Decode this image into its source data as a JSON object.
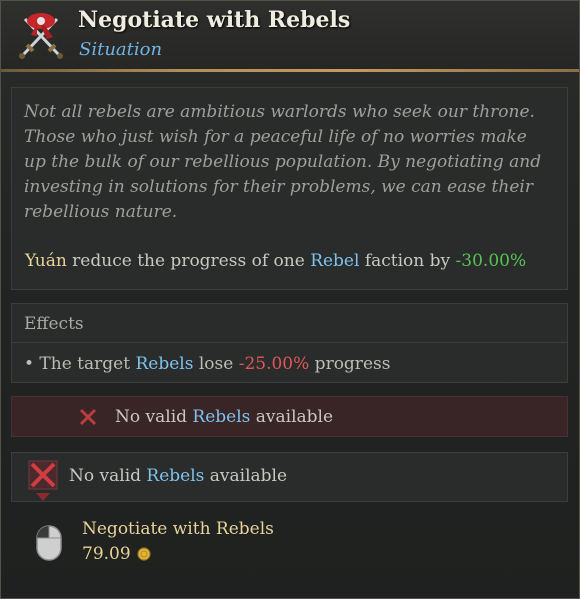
{
  "header": {
    "title": "Negotiate with Rebels",
    "subtitle": "Situation",
    "icon": "crossed-swords-icon"
  },
  "description": {
    "flavor": "Not all rebels are ambitious warlords who seek our throne. Those who just wish for a peaceful life of no worries make up the bulk of our rebellious population. By negotiating and investing in solutions for their problems, we can ease their rebellious nature.",
    "effect_subject": "Yuán",
    "effect_mid": " reduce the progress of one ",
    "effect_faction": "Rebel",
    "effect_tail": " faction by ",
    "effect_value": "-30.00%"
  },
  "effects": {
    "title": "Effects",
    "bullet": "•",
    "prefix": " The target ",
    "target": "Rebels",
    "mid": " lose ",
    "value": "-25.00%",
    "suffix": " progress"
  },
  "invalid": {
    "prefix": "No valid ",
    "target": "Rebels",
    "suffix": " available",
    "icon": "red-x-icon"
  },
  "condition": {
    "prefix": "No valid ",
    "target": "Rebels",
    "suffix": " available",
    "icon": "condition-failed-icon"
  },
  "action": {
    "name": "Negotiate with Rebels",
    "cost": "79.09",
    "cost_icon": "gold-coin-icon",
    "input_icon": "left-mouse-icon"
  },
  "colors": {
    "title": "#f1ece0",
    "subtitle": "#71b3e3",
    "keyword_blue": "#7ec2ee",
    "keyword_gold": "#e8d39a",
    "positive_green": "#58c354",
    "negative_red": "#e0575b",
    "divider_gold": "#c59b5d",
    "invalid_bg": "#3a2526"
  }
}
